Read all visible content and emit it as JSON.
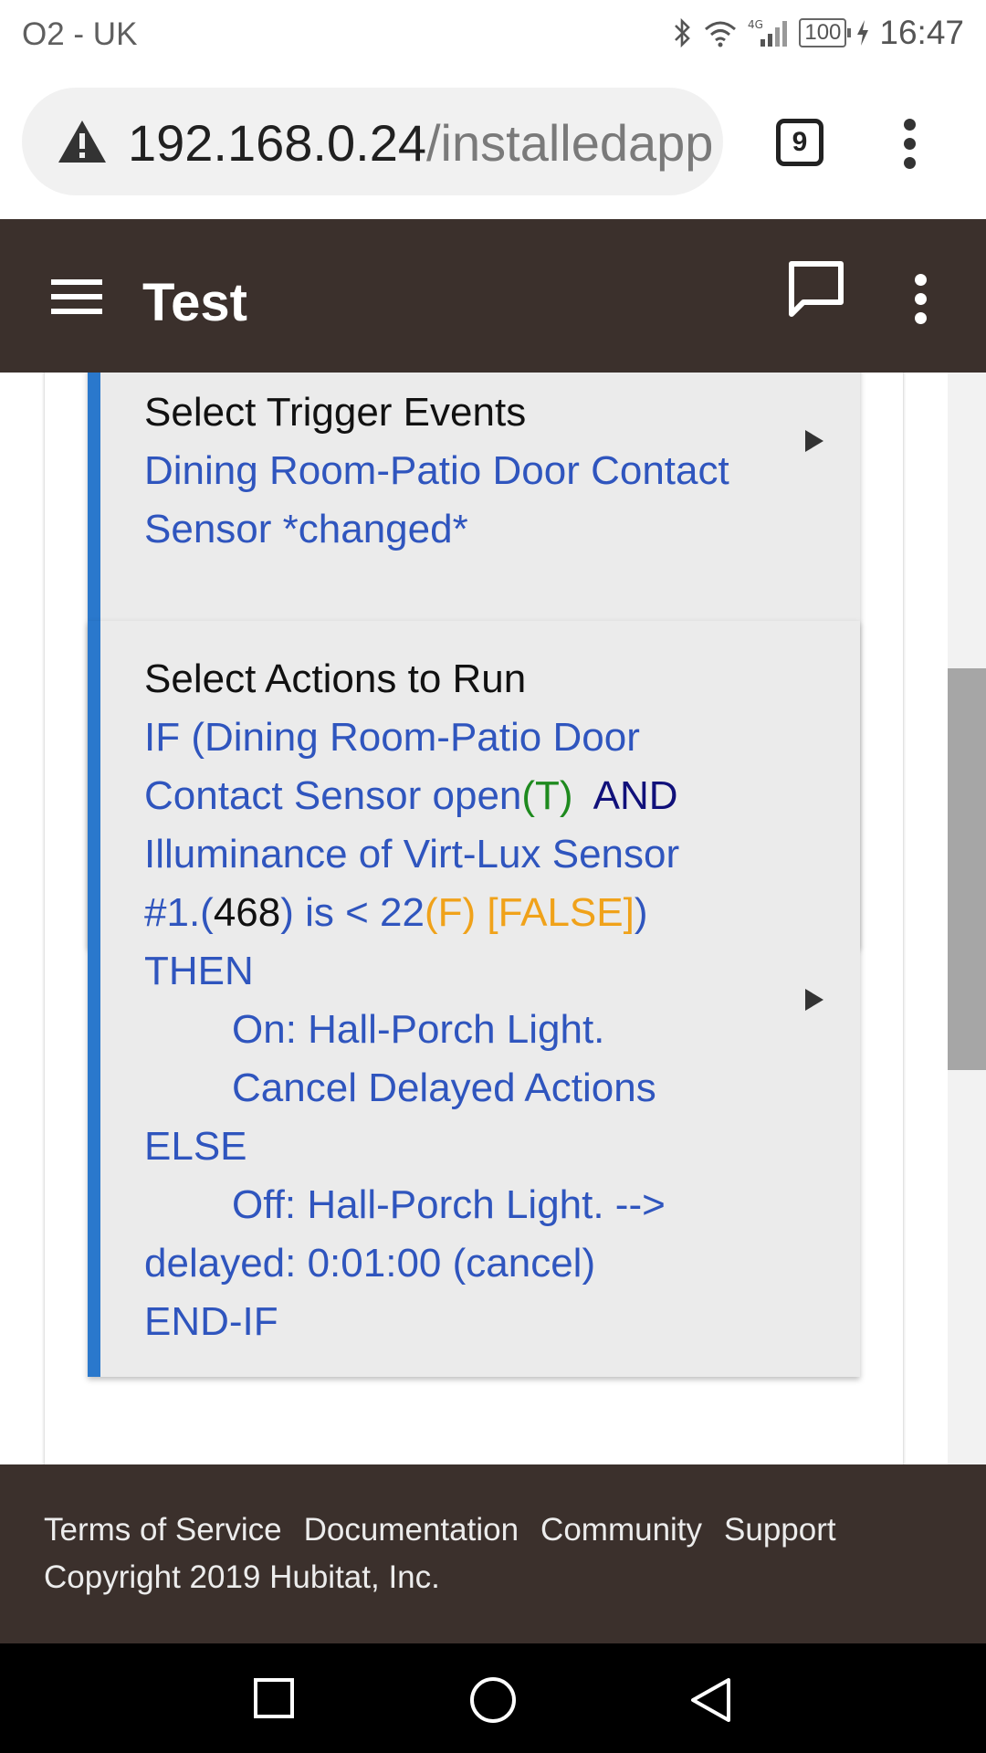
{
  "status_bar": {
    "carrier": "O2 - UK",
    "battery": "100",
    "time": "16:47",
    "network": "4G",
    "icons": [
      "bluetooth-icon",
      "wifi-icon",
      "signal-icon",
      "battery-icon",
      "charging-icon"
    ]
  },
  "browser": {
    "url_host": "192.168.0.24",
    "url_path": "/installedapp",
    "tab_count": "9",
    "icons": [
      "warning-icon",
      "tabs-icon",
      "more-vert-icon"
    ]
  },
  "header": {
    "title": "Test",
    "icons": [
      "menu-icon",
      "chat-icon",
      "more-vert-icon"
    ]
  },
  "sections": [
    {
      "title": "Select Trigger Events",
      "body": "Dining Room-Patio Door Contact Sensor *changed*"
    },
    {
      "title": "Select Actions to Run",
      "lines": {
        "l1": "IF (Dining Room-Patio Door",
        "l2a": "Contact Sensor open",
        "l2b": "(T)",
        "l2c": "AND",
        "l3": "Illuminance of Virt-Lux Sensor",
        "l4a": "#1.(",
        "l4b": "468",
        "l4c": ") is < 22",
        "l4d": "(F)",
        "l4e": "[FALSE]",
        "l4f": ")",
        "l5": "THEN",
        "l6": "On: Hall-Porch Light.",
        "l7": "Cancel Delayed Actions",
        "l8": "ELSE",
        "l9": "Off: Hall-Porch Light. -->",
        "l10": "delayed: 0:01:00 (cancel)",
        "l11": "END-IF"
      }
    }
  ],
  "footer": {
    "links": [
      "Terms of Service",
      "Documentation",
      "Community",
      "Support"
    ],
    "copyright": "Copyright 2019 Hubitat, Inc."
  },
  "colors": {
    "header_bg": "#3b302c",
    "section_accent": "#2a78cc",
    "link_text": "#2f55be",
    "true_green": "#1e8a1e",
    "false_orange": "#f0a21a"
  }
}
